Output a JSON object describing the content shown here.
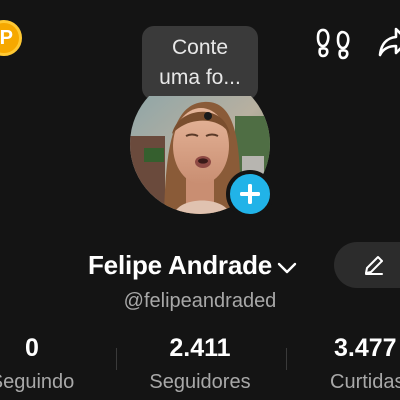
{
  "tooltip": {
    "text": "Conte uma fo..."
  },
  "coin": {
    "letter": "P"
  },
  "profile": {
    "display_name": "Felipe Andrade",
    "username": "@felipeandraded"
  },
  "stats": [
    {
      "value": "0",
      "label": "Seguindo"
    },
    {
      "value": "2.411",
      "label": "Seguidores"
    },
    {
      "value": "3.477",
      "label": "Curtidas"
    }
  ],
  "colors": {
    "background": "#141414",
    "accent_blue": "#21b3e8",
    "coin_gold": "#f6a800",
    "secondary_text": "#a8a8a8"
  },
  "icons": [
    "coin-icon",
    "footprints-icon",
    "share-icon",
    "plus-icon",
    "chevron-down-icon",
    "pencil-icon"
  ]
}
